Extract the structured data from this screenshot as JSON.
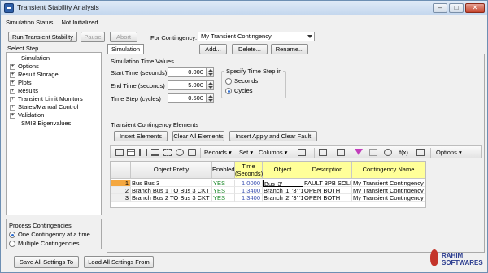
{
  "window": {
    "title": "Transient Stability Analysis"
  },
  "status": {
    "label": "Simulation Status",
    "value": "Not Initialized"
  },
  "top_buttons": {
    "run": "Run Transient Stability",
    "pause": "Pause",
    "abort": "Abort"
  },
  "contingency_select": {
    "label": "For Contingency:",
    "value": "My Transient Contingency"
  },
  "step_panel": {
    "title": "Select Step",
    "items": [
      {
        "label": "Simulation",
        "expandable": false
      },
      {
        "label": "Options",
        "expandable": true
      },
      {
        "label": "Result Storage",
        "expandable": true
      },
      {
        "label": "Plots",
        "expandable": true
      },
      {
        "label": "Results",
        "expandable": true
      },
      {
        "label": "Transient Limit Monitors",
        "expandable": true
      },
      {
        "label": "States/Manual Control",
        "expandable": true
      },
      {
        "label": "Validation",
        "expandable": true
      },
      {
        "label": "SMIB Eigenvalues",
        "expandable": false
      }
    ]
  },
  "tabs": {
    "active": "Simulation"
  },
  "tab_buttons": {
    "add": "Add...",
    "delete": "Delete...",
    "rename": "Rename..."
  },
  "sim_time": {
    "title": "Simulation Time Values",
    "start_label": "Start Time (seconds)",
    "start_value": "0.000",
    "end_label": "End Time (seconds)",
    "end_value": "5.000",
    "step_label": "Time Step (cycles)",
    "step_value": "0.500"
  },
  "time_step_group": {
    "title": "Specify Time Step in",
    "seconds": "Seconds",
    "cycles": "Cycles",
    "selected": "cycles"
  },
  "contingency_elements": {
    "title": "Transient Contingency Elements",
    "insert": "Insert Elements",
    "clear": "Clear All Elements",
    "insert_apply": "Insert Apply and Clear Fault"
  },
  "toolbar": {
    "records": "Records",
    "set": "Set",
    "columns": "Columns",
    "fx": "f(x)",
    "options": "Options"
  },
  "grid": {
    "headers": [
      "Object Pretty",
      "Enabled",
      "Time (Seconds)",
      "Object",
      "Description",
      "Contingency Name"
    ],
    "rows": [
      {
        "n": "1",
        "pretty": "Bus Bus 3",
        "enabled": "YES",
        "time": "1.0000",
        "object": "Bus '3'",
        "desc": "FAULT 3PB SOLID",
        "cont": "My Transient Contingency"
      },
      {
        "n": "2",
        "pretty": "Branch Bus 1  TO  Bus 3 CKT 1",
        "enabled": "YES",
        "time": "1.3400",
        "object": "Branch '1' '3' '1'",
        "desc": "OPEN BOTH",
        "cont": "My Transient Contingency"
      },
      {
        "n": "3",
        "pretty": "Branch Bus 2  TO  Bus 3 CKT 1",
        "enabled": "YES",
        "time": "1.3400",
        "object": "Branch '2' '3' '1'",
        "desc": "OPEN BOTH",
        "cont": "My Transient Contingency"
      }
    ]
  },
  "process": {
    "title": "Process Contingencies",
    "one": "One Contingency at a time",
    "multiple": "Multiple Contingencies",
    "selected": "one"
  },
  "bottom_buttons": {
    "save": "Save All Settings To",
    "load": "Load All Settings From"
  },
  "watermark": {
    "text": "RAHIM SOFTWARES"
  }
}
